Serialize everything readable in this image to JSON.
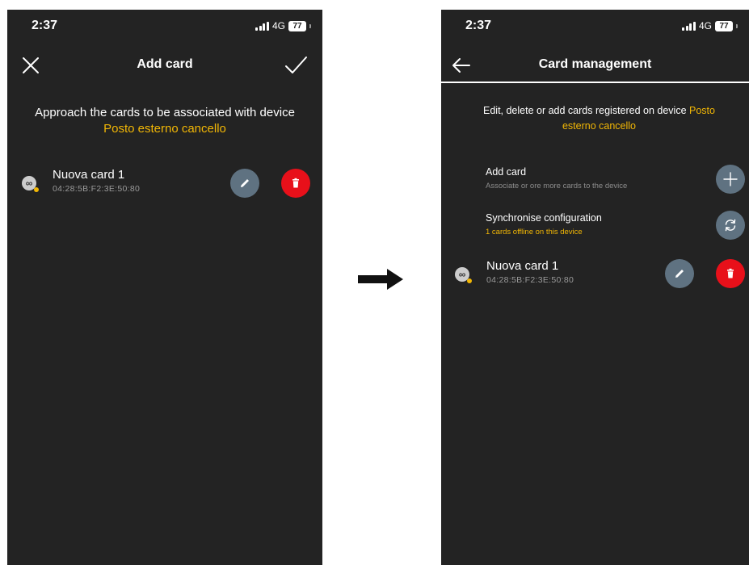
{
  "left_screen": {
    "status": {
      "time": "2:37",
      "network": "4G",
      "battery": "77"
    },
    "header": {
      "title": "Add card"
    },
    "intro": {
      "text": "Approach the cards to be associated with device",
      "device": "Posto esterno cancello"
    },
    "card": {
      "avatar": "∞",
      "name": "Nuova card 1",
      "mac": "04:28:5B:F2:3E:50:80"
    }
  },
  "right_screen": {
    "status": {
      "time": "2:37",
      "network": "4G",
      "battery": "77"
    },
    "header": {
      "title": "Card management"
    },
    "intro": {
      "text": "Edit, delete or add cards registered on device",
      "device": "Posto esterno cancello"
    },
    "options": {
      "add": {
        "title": "Add card",
        "subtitle": "Associate or ore more cards to the device"
      },
      "sync": {
        "title": "Synchronise configuration",
        "subtitle": "1 cards offline on this device"
      }
    },
    "card": {
      "avatar": "∞",
      "name": "Nuova card 1",
      "mac": "04:28:5B:F2:3E:50:80"
    }
  },
  "icons": {
    "close": "close-icon",
    "check": "check-icon",
    "back": "back-arrow-icon",
    "edit": "pencil-icon",
    "delete": "trash-icon",
    "add": "plus-icon",
    "sync": "sync-icon",
    "transition": "right-arrow-icon"
  },
  "colors": {
    "background": "#232323",
    "accent": "#f2b705",
    "edit_button": "#5f7281",
    "delete_button": "#e8101a"
  }
}
